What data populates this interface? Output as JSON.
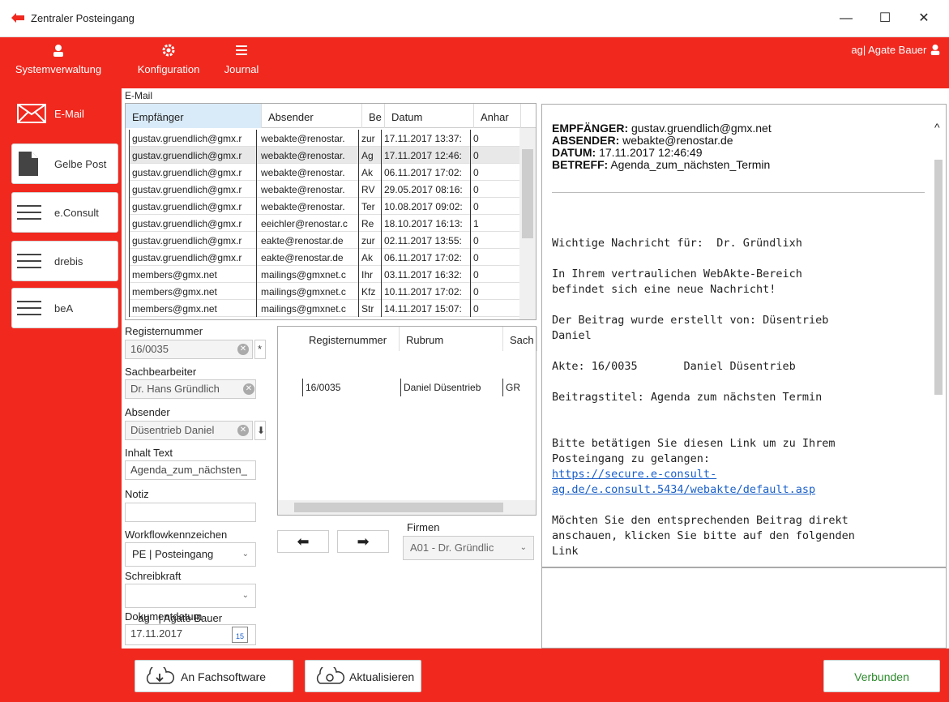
{
  "window": {
    "title": "Zentraler Posteingang",
    "minimize": "—",
    "maximize": "☐",
    "close": "✕"
  },
  "toolbar": {
    "system_label": "Systemverwaltung",
    "config_label": "Konfiguration",
    "journal_label": "Journal",
    "user": "ag| Agate Bauer"
  },
  "nav": {
    "email": "E-Mail",
    "gelbe_post": "Gelbe Post",
    "econsult": "e.Consult",
    "drebis": "drebis",
    "bea": "beA"
  },
  "email_section_label": "E-Mail",
  "email_grid": {
    "headers": [
      "Empfänger",
      "Absender",
      "Be",
      "Datum",
      "Anhar"
    ],
    "rows": [
      [
        "gustav.gruendlich@gmx.r",
        "webakte@renostar.",
        "zur",
        "17.11.2017 13:37:",
        "0"
      ],
      [
        "gustav.gruendlich@gmx.r",
        "webakte@renostar.",
        "Ag",
        "17.11.2017 12:46:",
        "0"
      ],
      [
        "gustav.gruendlich@gmx.r",
        "webakte@renostar.",
        "Ak",
        "06.11.2017 17:02:",
        "0"
      ],
      [
        "gustav.gruendlich@gmx.r",
        "webakte@renostar.",
        "RV",
        "29.05.2017 08:16:",
        "0"
      ],
      [
        "gustav.gruendlich@gmx.r",
        "webakte@renostar.",
        "Ter",
        "10.08.2017 09:02:",
        "0"
      ],
      [
        "gustav.gruendlich@gmx.r",
        "eeichler@renostar.c",
        "Re",
        "18.10.2017 16:13:",
        "1"
      ],
      [
        "gustav.gruendlich@gmx.r",
        "eakte@renostar.de",
        "zur",
        "02.11.2017 13:55:",
        "0"
      ],
      [
        "gustav.gruendlich@gmx.r",
        "eakte@renostar.de",
        "Ak",
        "06.11.2017 17:02:",
        "0"
      ],
      [
        "members@gmx.net",
        "mailings@gmxnet.c",
        "Ihr",
        "03.11.2017 16:32:",
        "0"
      ],
      [
        "members@gmx.net",
        "mailings@gmxnet.c",
        "Kfz",
        "10.11.2017 17:02:",
        "0"
      ],
      [
        "members@gmx.net",
        "mailings@gmxnet.c",
        "Str",
        "14.11.2017 15:07:",
        "0"
      ]
    ]
  },
  "form": {
    "registernummer_label": "Registernummer",
    "registernummer_value": "16/0035",
    "sachbearbeiter_label": "Sachbearbeiter",
    "sachbearbeiter_value": "Dr. Hans Gründlich",
    "absender_label": "Absender",
    "absender_value": "Düsentrieb Daniel",
    "inhalt_label": "Inhalt Text",
    "inhalt_value": "Agenda_zum_nächsten_",
    "notiz_label": "Notiz",
    "notiz_value": "",
    "workflow_label": "Workflowkennzeichen",
    "workflow_value": "PE | Posteingang",
    "schreibkraft_label": "Schreibkraft",
    "schreibkraft_value": "ag   | Agate Bauer",
    "dokumentdatum_label": "Dokumentdatum",
    "dokumentdatum_value": "17.11.2017",
    "calendar_day": "15",
    "star": "*"
  },
  "rubrum_grid": {
    "headers": [
      "Registernummer",
      "Rubrum",
      "Sach"
    ],
    "row": [
      "16/0035",
      "Daniel Düsentrieb",
      "GR"
    ]
  },
  "firmen": {
    "label": "Firmen",
    "value": "A01 - Dr. Gründlic"
  },
  "arrows": {
    "left": "⬅",
    "right": "➡"
  },
  "preview": {
    "empfaenger_key": "EMPFÄNGER:",
    "empfaenger_val": "gustav.gruendlich@gmx.net",
    "absender_key": "ABSENDER:",
    "absender_val": "webakte@renostar.de",
    "datum_key": "DATUM:",
    "datum_val": "17.11.2017 12:46:49",
    "betreff_key": "BETREFF:",
    "betreff_val": "Agenda_zum_nächsten_Termin",
    "line1": "Wichtige Nachricht für:  Dr. Gründlixh",
    "line2": "In Ihrem vertraulichen WebAkte-Bereich",
    "line3": "befindet sich eine neue Nachricht!",
    "line4": "Der Beitrag wurde erstellt von: Düsentrieb",
    "line5": "Daniel",
    "line6": "Akte: 16/0035       Daniel Düsentrieb",
    "line7": "Beitragstitel: Agenda zum nächsten Termin",
    "line8": "Bitte betätigen Sie diesen Link um zu Ihrem",
    "line9": "Posteingang zu gelangen:",
    "link1": "https://secure.e-consult-",
    "link2": "ag.de/e.consult.5434/webakte/default.asp",
    "line10": "Möchten Sie den entsprechenden Beitrag direkt",
    "line11": "anschauen, klicken Sie bitte auf den folgenden",
    "line12": "Link"
  },
  "bottom": {
    "fachsoftware": "An Fachsoftware",
    "aktualisieren": "Aktualisieren",
    "verbunden": "Verbunden"
  },
  "colors": {
    "accent": "#f0281e",
    "connected": "#2e8b2e"
  }
}
